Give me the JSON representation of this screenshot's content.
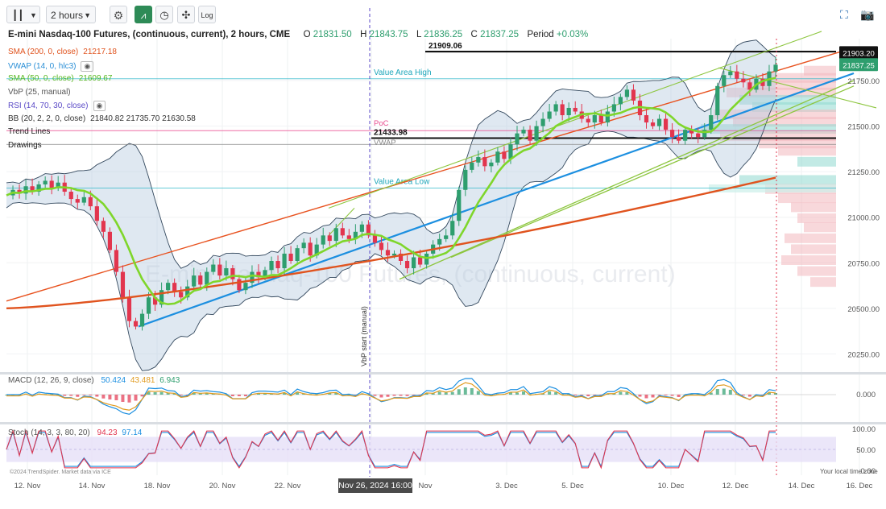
{
  "toolbar": {
    "interval": "2 hours",
    "log_label": "Log"
  },
  "header": {
    "symbol": "E-mini Nasdaq-100 Futures, (continuous, current), 2 hours, CME",
    "o_label": "O",
    "o_value": "21831.50",
    "h_label": "H",
    "h_value": "21843.75",
    "l_label": "L",
    "l_value": "21836.25",
    "c_label": "C",
    "c_value": "21837.25",
    "period_label": "Period",
    "period_value": "+0.03%"
  },
  "legend": [
    {
      "label": "SMA (200, 0, close)",
      "value": "21217.18",
      "color": "#e0531e",
      "value_color": "#e0531e"
    },
    {
      "label": "VWAP (14, 0, hlc3)",
      "value": "",
      "color": "#2a8fd6",
      "value_color": "#2a8fd6",
      "eye": true
    },
    {
      "label": "SMA (50, 0, close)",
      "value": "21609.67",
      "color": "#55b81f",
      "value_color": "#55b81f"
    },
    {
      "label": "VbP (25, manual)",
      "value": "",
      "color": "#555555",
      "value_color": "#555555"
    },
    {
      "label": "RSI (14, 70, 30, close)",
      "value": "",
      "color": "#5a4ac7",
      "value_color": "#5a4ac7",
      "eye": true
    },
    {
      "label": "BB (20, 2, 2, 0, close)",
      "value": "21840.82  21735.70  21630.58",
      "color": "#333333",
      "value_color": "#333333"
    },
    {
      "label": "Trend Lines",
      "value": "",
      "color": "#222222",
      "value_color": "#222222"
    },
    {
      "label": "Drawings",
      "value": "",
      "color": "#222222",
      "value_color": "#222222"
    }
  ],
  "watermark": "E-mini Nasdaq-100 Futures, (continuous, current)",
  "annotations": {
    "level_top": "21909.06",
    "value_area_high": "Value Area High",
    "poc": "PoC",
    "level_mid": "21433.98",
    "vwap": "VWAP",
    "value_area_low": "Value Area Low",
    "vbp_start": "VbP start (manual)"
  },
  "price_tags": {
    "upper": "21903.20",
    "current": "21837.25"
  },
  "macd": {
    "label": "MACD (12, 26, 9, close)",
    "macd": "50.424",
    "signal": "43.481",
    "hist": "6.943",
    "axis_label": "0.000"
  },
  "stoch": {
    "label": "Stoch (14, 3, 3, 80, 20)",
    "k": "94.23",
    "d": "97.14",
    "ticks": [
      "100.00",
      "50.00",
      "0.00"
    ]
  },
  "footer": {
    "copyright": "©2024 TrendSpider. Market data via ICE",
    "local_time": "Your local time zone"
  },
  "crosshair_date": "Nov 26, 2024 16:00",
  "colors": {
    "sma200": "#e0531e",
    "sma50": "#7fd62b",
    "vwap": "#1c8fe0",
    "channel": "#8dc63f",
    "bb_fill": "#b9cce0",
    "candle_up": "#2e9e6e",
    "candle_down": "#e2354e",
    "value_area": "#25b5c8",
    "poc": "#e84a8e",
    "crosshair": "#5a4ac7"
  },
  "chart_data": {
    "type": "candlestick",
    "x_ticks": [
      "12. Nov",
      "14. Nov",
      "18. Nov",
      "20. Nov",
      "22. Nov",
      "Nov",
      "3. Dec",
      "5. Dec",
      "10. Dec",
      "12. Dec",
      "14. Dec",
      "16. Dec"
    ],
    "y_ticks": [
      21750,
      21500,
      21250,
      21000,
      20750,
      20500,
      20250
    ],
    "y_tick_labels": [
      "21750.00",
      "21500.00",
      "21250.00",
      "21000.00",
      "20750.00",
      "20500.00",
      "20250.00"
    ],
    "ylim": [
      20150,
      21980
    ],
    "close_path": [
      21120,
      21150,
      21130,
      21170,
      21140,
      21180,
      21200,
      21160,
      21190,
      21140,
      21100,
      21080,
      21110,
      21060,
      20980,
      20920,
      20820,
      20700,
      20560,
      20430,
      20400,
      20470,
      20560,
      20520,
      20600,
      20640,
      20590,
      20560,
      20620,
      20680,
      20630,
      20700,
      20740,
      20680,
      20720,
      20660,
      20600,
      20640,
      20700,
      20670,
      20710,
      20760,
      20720,
      20800,
      20760,
      20830,
      20860,
      20790,
      20850,
      20900,
      20870,
      20940,
      20900,
      20880,
      20920,
      20960,
      20900,
      20860,
      20820,
      20790,
      20800,
      20760,
      20720,
      20780,
      20740,
      20800,
      20850,
      20880,
      20900,
      20980,
      21150,
      21260,
      21300,
      21330,
      21280,
      21300,
      21360,
      21320,
      21400,
      21460,
      21480,
      21420,
      21500,
      21540,
      21580,
      21620,
      21560,
      21600,
      21580,
      21540,
      21520,
      21560,
      21520,
      21580,
      21620,
      21660,
      21700,
      21640,
      21560,
      21520,
      21500,
      21540,
      21480,
      21440,
      21420,
      21480,
      21460,
      21440,
      21480,
      21560,
      21720,
      21780,
      21800,
      21760,
      21740,
      21700,
      21760,
      21720,
      21800,
      21837
    ],
    "sma200_levels": [
      20500,
      21217.18
    ],
    "sma50_last": 21609.67,
    "bb": {
      "upper": 21840.82,
      "middle": 21735.7,
      "lower": 21630.58
    },
    "levels": {
      "top": 21909.06,
      "value_area_high": 21760,
      "poc": 21475,
      "mid": 21433.98,
      "vwap": 21400,
      "value_area_low": 21160,
      "upper_tag": 21903.2,
      "current": 21837.25
    },
    "macd": {
      "macd": 50.424,
      "signal": 43.481,
      "hist": 6.943
    },
    "stoch": {
      "k": 94.23,
      "d": 97.14,
      "upper": 80,
      "lower": 20
    }
  }
}
